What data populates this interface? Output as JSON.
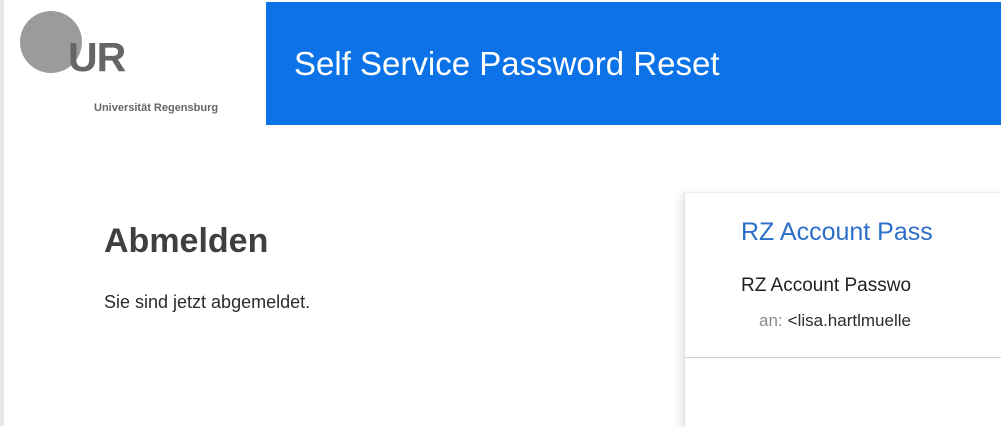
{
  "logo": {
    "letters": "UR",
    "subtitle": "Universität Regensburg",
    "colors": {
      "circle": "#9b9b9b",
      "text": "#666666"
    }
  },
  "header": {
    "title": "Self Service Password Reset",
    "background": "#0b72e7"
  },
  "main": {
    "heading": "Abmelden",
    "message": "Sie sind jetzt abgemeldet."
  },
  "email_card": {
    "title": "RZ Account Pass",
    "subject": "RZ Account Passwo",
    "to_label": "an:",
    "to_value": "<lisa.hartlmuelle",
    "accent": "#2b6fca"
  }
}
